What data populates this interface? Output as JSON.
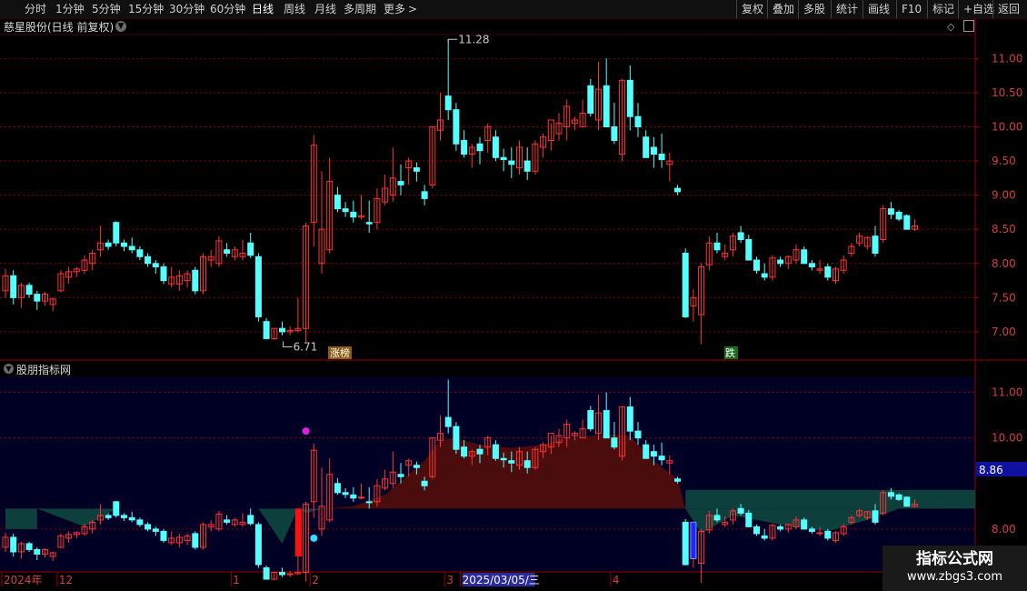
{
  "toolbar": {
    "left": [
      {
        "label": "分时",
        "x": 14,
        "active": false
      },
      {
        "label": "1分钟",
        "x": 60,
        "active": false
      },
      {
        "label": "5分钟",
        "x": 100,
        "active": false
      },
      {
        "label": "15分钟",
        "x": 141,
        "active": false
      },
      {
        "label": "30分钟",
        "x": 186,
        "active": false
      },
      {
        "label": "60分钟",
        "x": 231,
        "active": false
      },
      {
        "label": "日线",
        "x": 277,
        "active": true
      },
      {
        "label": "周线",
        "x": 312,
        "active": false
      },
      {
        "label": "月线",
        "x": 346,
        "active": false
      },
      {
        "label": "多周期",
        "x": 378,
        "active": false
      },
      {
        "label": "更多",
        "x": 422,
        "active": false
      }
    ],
    "more_arrow": ">",
    "right": [
      {
        "label": "复权",
        "x": 810
      },
      {
        "label": "叠加",
        "x": 844
      },
      {
        "label": "多股",
        "x": 878
      },
      {
        "label": "统计",
        "x": 914
      },
      {
        "label": "画线",
        "x": 949
      },
      {
        "label": "F10",
        "x": 986
      },
      {
        "label": "标记",
        "x": 1020
      },
      {
        "label": "+自选",
        "x": 1054
      },
      {
        "label": "返回",
        "x": 1093
      }
    ]
  },
  "chart_title": "慈星股份(日线 前复权)",
  "sub_panel_title": "股朋指标网",
  "price_labels": {
    "high": "11.28",
    "low": "6.71"
  },
  "badges": {
    "limit_up": "涨榜",
    "fall": "跌"
  },
  "current_value": "8.86",
  "watermark": {
    "line1": "指标公式网",
    "line2": "www.zbgs3.com"
  },
  "colors": {
    "up": "#ff3232",
    "down": "#54ffff",
    "grid": "#8b0000",
    "ribbon_red": "#4a0c0c",
    "ribbon_teal": "#0d3f3c",
    "sub_bg": "#000025"
  },
  "chart_data": [
    {
      "type": "candlestick",
      "ylim": [
        6.6,
        11.35
      ],
      "y_ticks": [
        "11.00",
        "10.50",
        "10.00",
        "9.50",
        "9.00",
        "8.50",
        "8.00",
        "7.50",
        "7.00"
      ],
      "tick_values": [
        11.0,
        10.5,
        10.0,
        9.5,
        9.0,
        8.5,
        8.0,
        7.5,
        7.0
      ],
      "ohlc": [
        [
          7.6,
          7.92,
          7.5,
          7.82
        ],
        [
          7.82,
          7.9,
          7.4,
          7.5
        ],
        [
          7.5,
          7.72,
          7.35,
          7.68
        ],
        [
          7.68,
          7.72,
          7.5,
          7.55
        ],
        [
          7.55,
          7.6,
          7.32,
          7.45
        ],
        [
          7.45,
          7.58,
          7.38,
          7.55
        ],
        [
          7.4,
          7.5,
          7.3,
          7.48
        ],
        [
          7.6,
          7.9,
          7.58,
          7.85
        ],
        [
          7.8,
          7.95,
          7.7,
          7.88
        ],
        [
          7.88,
          7.95,
          7.8,
          7.92
        ],
        [
          7.9,
          8.12,
          7.85,
          8.05
        ],
        [
          8.0,
          8.2,
          7.9,
          8.15
        ],
        [
          8.2,
          8.55,
          8.1,
          8.3
        ],
        [
          8.3,
          8.35,
          8.2,
          8.25
        ],
        [
          8.6,
          8.62,
          8.25,
          8.3
        ],
        [
          8.3,
          8.35,
          8.18,
          8.25
        ],
        [
          8.25,
          8.38,
          8.15,
          8.2
        ],
        [
          8.2,
          8.25,
          8.05,
          8.1
        ],
        [
          8.1,
          8.15,
          7.95,
          8.0
        ],
        [
          8.0,
          8.05,
          7.85,
          7.95
        ],
        [
          7.95,
          8.0,
          7.7,
          7.75
        ],
        [
          7.7,
          7.95,
          7.65,
          7.8
        ],
        [
          7.7,
          7.9,
          7.6,
          7.82
        ],
        [
          7.75,
          7.9,
          7.65,
          7.85
        ],
        [
          7.9,
          7.95,
          7.55,
          7.6
        ],
        [
          7.6,
          8.15,
          7.55,
          8.1
        ],
        [
          8.05,
          8.2,
          7.95,
          8.1
        ],
        [
          8.0,
          8.4,
          7.95,
          8.33
        ],
        [
          8.2,
          8.3,
          8.1,
          8.15
        ],
        [
          8.1,
          8.25,
          8.05,
          8.2
        ],
        [
          8.1,
          8.35,
          8.05,
          8.15
        ],
        [
          8.3,
          8.45,
          8.08,
          8.12
        ],
        [
          8.1,
          8.15,
          7.15,
          7.22
        ],
        [
          7.15,
          7.2,
          6.95,
          6.9
        ],
        [
          6.9,
          7.05,
          6.88,
          7.05
        ],
        [
          7.05,
          7.15,
          6.95,
          7.0
        ],
        [
          7.0,
          7.08,
          6.95,
          7.02
        ],
        [
          7.02,
          7.5,
          6.99,
          7.05
        ],
        [
          7.05,
          8.6,
          6.85,
          8.55
        ],
        [
          8.6,
          9.88,
          8.25,
          9.73
        ],
        [
          8.0,
          9.35,
          7.85,
          8.5
        ],
        [
          8.2,
          9.55,
          8.15,
          9.2
        ],
        [
          9.0,
          9.12,
          8.75,
          8.8
        ],
        [
          8.8,
          8.9,
          8.68,
          8.76
        ],
        [
          8.75,
          8.92,
          8.6,
          8.68
        ],
        [
          8.68,
          9.0,
          8.65,
          8.7
        ],
        [
          8.6,
          8.92,
          8.45,
          8.58
        ],
        [
          8.6,
          9.1,
          8.5,
          8.95
        ],
        [
          8.9,
          9.3,
          8.85,
          9.1
        ],
        [
          9.0,
          9.7,
          8.9,
          9.25
        ],
        [
          9.2,
          9.45,
          9.0,
          9.15
        ],
        [
          9.4,
          9.55,
          9.15,
          9.5
        ],
        [
          9.4,
          9.48,
          9.2,
          9.35
        ],
        [
          9.05,
          9.15,
          8.85,
          8.95
        ],
        [
          9.15,
          10.0,
          9.1,
          10.0
        ],
        [
          9.95,
          10.5,
          9.8,
          10.1
        ],
        [
          10.45,
          11.28,
          10.1,
          10.25
        ],
        [
          10.25,
          10.35,
          9.65,
          9.75
        ],
        [
          9.8,
          9.95,
          9.55,
          9.6
        ],
        [
          9.6,
          9.75,
          9.4,
          9.7
        ],
        [
          9.75,
          9.85,
          9.45,
          9.65
        ],
        [
          9.8,
          10.05,
          9.62,
          10.0
        ],
        [
          9.85,
          9.95,
          9.5,
          9.55
        ],
        [
          9.55,
          9.68,
          9.35,
          9.52
        ],
        [
          9.5,
          9.7,
          9.25,
          9.45
        ],
        [
          9.4,
          9.8,
          9.3,
          9.7
        ],
        [
          9.5,
          9.7,
          9.22,
          9.35
        ],
        [
          9.35,
          9.8,
          9.3,
          9.75
        ],
        [
          9.7,
          9.9,
          9.55,
          9.85
        ],
        [
          9.8,
          10.05,
          9.65,
          10.1
        ],
        [
          9.9,
          10.2,
          9.8,
          10.05
        ],
        [
          10.0,
          10.4,
          9.8,
          10.3
        ],
        [
          10.05,
          10.15,
          9.95,
          10.1
        ],
        [
          10.0,
          10.4,
          10.0,
          10.2
        ],
        [
          10.6,
          10.7,
          10.15,
          10.2
        ],
        [
          10.1,
          10.95,
          9.95,
          10.55
        ],
        [
          10.6,
          11.0,
          10.2,
          10.0
        ],
        [
          10.0,
          10.35,
          9.75,
          9.8
        ],
        [
          9.6,
          10.7,
          9.5,
          10.68
        ],
        [
          10.68,
          10.9,
          9.95,
          10.15
        ],
        [
          10.15,
          10.35,
          9.85,
          10.0
        ],
        [
          9.85,
          9.95,
          9.62,
          9.55
        ],
        [
          9.7,
          9.85,
          9.4,
          9.6
        ],
        [
          9.6,
          9.9,
          9.4,
          9.52
        ],
        [
          9.45,
          9.62,
          9.2,
          9.5
        ],
        [
          9.1,
          9.15,
          9.0,
          9.05
        ],
        [
          8.15,
          8.22,
          7.2,
          7.22
        ],
        [
          7.38,
          7.62,
          7.15,
          7.5
        ],
        [
          7.25,
          8.0,
          6.82,
          7.95
        ],
        [
          7.98,
          8.4,
          7.9,
          8.3
        ],
        [
          8.3,
          8.45,
          8.15,
          8.2
        ],
        [
          8.1,
          8.28,
          8.05,
          8.15
        ],
        [
          8.2,
          8.45,
          8.1,
          8.4
        ],
        [
          8.45,
          8.55,
          8.3,
          8.35
        ],
        [
          8.35,
          8.42,
          8.15,
          8.05
        ],
        [
          8.05,
          8.1,
          7.85,
          7.9
        ],
        [
          7.85,
          8.0,
          7.75,
          7.8
        ],
        [
          7.8,
          8.12,
          7.75,
          8.08
        ],
        [
          8.05,
          8.1,
          7.95,
          8.0
        ],
        [
          8.0,
          8.12,
          7.92,
          8.1
        ],
        [
          8.05,
          8.28,
          8.0,
          8.2
        ],
        [
          8.2,
          8.25,
          8.1,
          8.0
        ],
        [
          8.0,
          8.05,
          7.9,
          7.95
        ],
        [
          7.9,
          8.05,
          7.85,
          7.92
        ],
        [
          7.95,
          8.0,
          7.75,
          7.8
        ],
        [
          7.75,
          7.95,
          7.7,
          7.92
        ],
        [
          7.9,
          8.12,
          7.85,
          8.05
        ],
        [
          8.15,
          8.3,
          8.1,
          8.25
        ],
        [
          8.3,
          8.45,
          8.25,
          8.4
        ],
        [
          8.25,
          8.4,
          8.2,
          8.38
        ],
        [
          8.4,
          8.55,
          8.1,
          8.15
        ],
        [
          8.35,
          8.85,
          8.3,
          8.8
        ],
        [
          8.8,
          8.9,
          8.65,
          8.72
        ],
        [
          8.75,
          8.78,
          8.62,
          8.65
        ],
        [
          8.7,
          8.72,
          8.5,
          8.5
        ],
        [
          8.5,
          8.65,
          8.48,
          8.55
        ]
      ],
      "annotations": [
        "11.28",
        "6.71",
        "涨榜",
        "跌"
      ]
    },
    {
      "type": "candlestick",
      "ylim": [
        7.08,
        11.35
      ],
      "y_ticks": [
        "11.00",
        "10.00",
        "8.00"
      ],
      "tick_values": [
        11.0,
        10.0,
        8.0
      ],
      "ribbon_base": 8.45,
      "ribbon": [
        [
          0,
          8.45
        ],
        [
          4,
          8.45
        ],
        [
          10,
          8.05
        ],
        [
          14,
          8.45
        ],
        [
          18,
          8.45
        ],
        [
          20,
          8.45
        ],
        [
          26,
          8.45
        ],
        [
          32,
          8.45
        ],
        [
          35,
          7.68
        ],
        [
          37,
          8.45
        ],
        [
          38,
          8.35
        ],
        [
          40,
          8.45
        ],
        [
          44,
          8.5
        ],
        [
          48,
          8.75
        ],
        [
          51,
          9.2
        ],
        [
          53,
          9.5
        ],
        [
          55,
          9.95
        ],
        [
          57,
          10.0
        ],
        [
          60,
          9.85
        ],
        [
          64,
          9.78
        ],
        [
          68,
          9.85
        ],
        [
          71,
          10.0
        ],
        [
          73,
          10.02
        ],
        [
          76,
          10.08
        ],
        [
          79,
          10.05
        ],
        [
          82,
          9.5
        ],
        [
          85,
          9.1
        ],
        [
          86,
          8.45
        ],
        [
          88,
          7.9
        ],
        [
          92,
          8.3
        ],
        [
          98,
          8.1
        ],
        [
          104,
          7.95
        ],
        [
          109,
          8.2
        ],
        [
          113,
          8.65
        ],
        [
          117,
          8.75
        ],
        [
          119,
          8.75
        ]
      ],
      "markers": {
        "magenta_dot": {
          "index": 38,
          "value": 10.15
        },
        "cyan_dot": {
          "index": 39,
          "value": 7.8
        },
        "red_bar": {
          "index": 37,
          "from": 7.4,
          "to": 8.45
        },
        "blue_bar": {
          "index": 87,
          "from": 7.35,
          "to": 8.15
        }
      }
    }
  ],
  "x_axis": {
    "labels": [
      {
        "text": "2024年",
        "index": 0
      },
      {
        "text": "12",
        "index": 7
      },
      {
        "text": "1",
        "index": 29
      },
      {
        "text": "2",
        "index": 39
      },
      {
        "text": "3",
        "index": 56
      },
      {
        "text": "2025/03/05/三",
        "index": 58
      },
      {
        "text": "4",
        "index": 77
      }
    ]
  }
}
